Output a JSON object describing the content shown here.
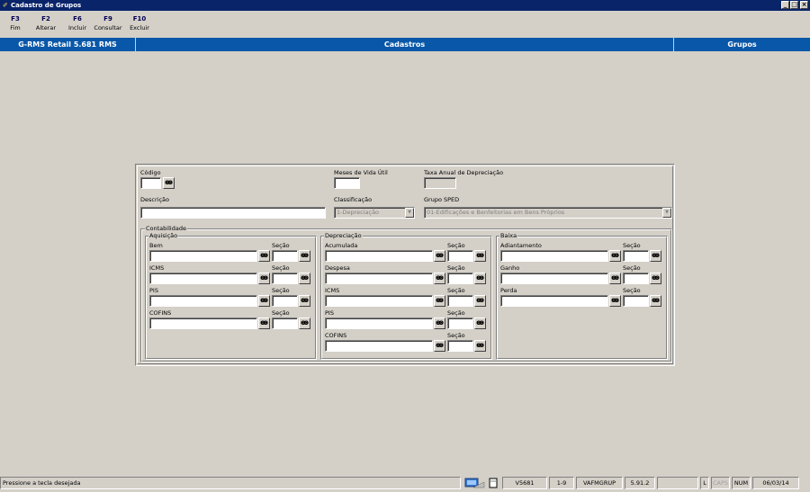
{
  "window": {
    "title": "Cadastro de Grupos"
  },
  "toolbar": {
    "keys": [
      {
        "key": "F3",
        "label": "Fim"
      },
      {
        "key": "F2",
        "label": "Alterar"
      },
      {
        "key": "F6",
        "label": "Incluir"
      },
      {
        "key": "F9",
        "label": "Consultar"
      },
      {
        "key": "F10",
        "label": "Excluir"
      }
    ]
  },
  "header": {
    "system": "G-RMS Retail 5.681 RMS",
    "module": "Cadastros",
    "screen": "Grupos"
  },
  "form": {
    "codigo_label": "Código",
    "meses_label": "Meses de Vida Útil",
    "taxa_label": "Taxa Anual de Depreciação",
    "descricao_label": "Descrição",
    "classificacao_label": "Classificação",
    "classificacao_value": "1-Depreciação",
    "grupo_sped_label": "Grupo SPED",
    "grupo_sped_value": "01-Edificações e Benfeitorias em Bens Próprios",
    "contabilidade_label": "Contabilidade",
    "secao_label": "Seção",
    "aquisicao": {
      "title": "Aquisição",
      "fields": [
        "Bem",
        "ICMS",
        "PIS",
        "COFINS"
      ]
    },
    "depreciacao": {
      "title": "Depreciação",
      "fields": [
        "Acumulada",
        "Despesa",
        "ICMS",
        "PIS",
        "COFINS"
      ]
    },
    "baixa": {
      "title": "Baixa",
      "fields": [
        "Adiantamento",
        "Ganho",
        "Perda"
      ]
    }
  },
  "status": {
    "message": "Pressione a tecla desejada",
    "version": "V5681",
    "page": "1-9",
    "program": "VAFMGRUP",
    "release": "5.91.2",
    "blank": "",
    "l": "L",
    "caps": "CAPS",
    "num": "NUM",
    "date": "06/03/14"
  }
}
